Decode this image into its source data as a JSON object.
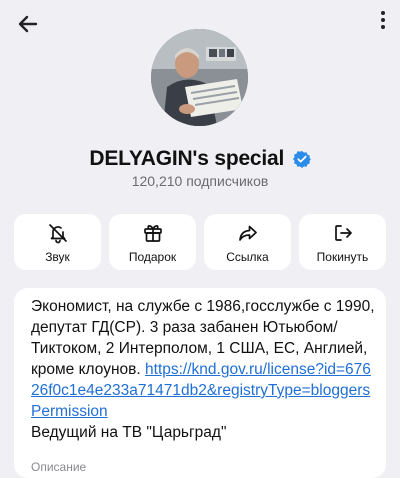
{
  "channel": {
    "name": "DELYAGIN's special",
    "subscribers": "120,210 подписчиков"
  },
  "actions": [
    {
      "label": "Звук",
      "icon": "bell-off-icon"
    },
    {
      "label": "Подарок",
      "icon": "gift-icon"
    },
    {
      "label": "Ссылка",
      "icon": "share-icon"
    },
    {
      "label": "Покинуть",
      "icon": "leave-icon"
    }
  ],
  "about": {
    "text1": "Экономист, на службе с 1986,госслужбе с 1990, депутат ГД(СР). 3 раза забанен Ютьюбом/Тиктоком, 2 Интерполом, 1 США, ЕС, Англией, кроме клоунов.",
    "link": "https://knd.gov.ru/license?id=67626f0c1e4e233a71471db2&registryType=bloggersPermission",
    "text2": "Ведущий на ТВ \"Царьград\"",
    "caption": "Описание"
  },
  "colors": {
    "background": "#f0f0f4",
    "card": "#ffffff",
    "link": "#1f6fd6",
    "verified": "#2a8be8",
    "secondary_text": "#6b6b70"
  }
}
